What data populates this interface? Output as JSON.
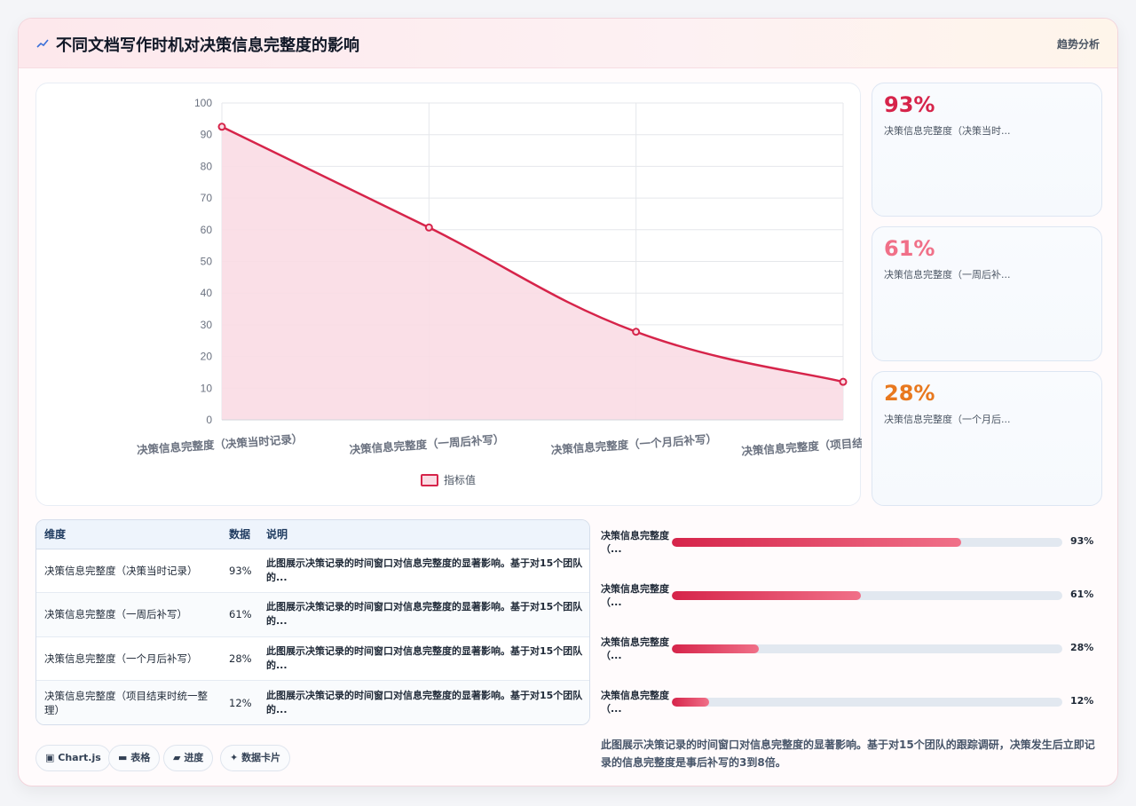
{
  "header": {
    "title": "不同文档写作时机对决策信息完整度的影响",
    "right_label": "趋势分析",
    "icon": "trend-line-icon"
  },
  "colors": {
    "line": "#d6244a",
    "area_fill": "#fadce4",
    "stat_1": "#d6244a",
    "stat_2": "#f07088",
    "stat_3": "#e8781e"
  },
  "chart_data": {
    "type": "line",
    "categories": [
      "决策信息完整度（决策当时记录）",
      "决策信息完整度（一周后补写）",
      "决策信息完整度（一个月后补写）",
      "决策信息完整度（项目结束时统一整理）"
    ],
    "series": [
      {
        "name": "指标值",
        "values": [
          92.5,
          60.7,
          27.8,
          12.0
        ]
      }
    ],
    "ylim": [
      0,
      100
    ],
    "yticks": [
      "0",
      "10",
      "20",
      "30",
      "40",
      "50",
      "60",
      "70",
      "80",
      "90",
      "100"
    ],
    "fill": true,
    "grid": true,
    "legend": "bottom"
  },
  "stats": [
    {
      "value": "93%",
      "label": "决策信息完整度（决策当时..."
    },
    {
      "value": "61%",
      "label": "决策信息完整度（一周后补..."
    },
    {
      "value": "28%",
      "label": "决策信息完整度（一个月后..."
    }
  ],
  "table": {
    "headers": [
      "维度",
      "数据",
      "说明"
    ],
    "rows": [
      {
        "dim": "决策信息完整度（决策当时记录）",
        "val": "93%",
        "desc": "此图展示决策记录的时间窗口对信息完整度的显著影响。基于对15个团队的..."
      },
      {
        "dim": "决策信息完整度（一周后补写）",
        "val": "61%",
        "desc": "此图展示决策记录的时间窗口对信息完整度的显著影响。基于对15个团队的..."
      },
      {
        "dim": "决策信息完整度（一个月后补写）",
        "val": "28%",
        "desc": "此图展示决策记录的时间窗口对信息完整度的显著影响。基于对15个团队的..."
      },
      {
        "dim": "决策信息完整度（项目结束时统一整理）",
        "val": "12%",
        "desc": "此图展示决策记录的时间窗口对信息完整度的显著影响。基于对15个团队的..."
      }
    ]
  },
  "progress": [
    {
      "label": "决策信息完整度（...",
      "value": "93%",
      "fraction": 0.74
    },
    {
      "label": "决策信息完整度（...",
      "value": "61%",
      "fraction": 0.485
    },
    {
      "label": "决策信息完整度（...",
      "value": "28%",
      "fraction": 0.222
    },
    {
      "label": "决策信息完整度（...",
      "value": "12%",
      "fraction": 0.095
    }
  ],
  "pills": [
    {
      "label": "Chart.js",
      "icon": "chart-icon"
    },
    {
      "label": "表格",
      "icon": "table-icon"
    },
    {
      "label": "进度",
      "icon": "progress-icon"
    },
    {
      "label": "数据卡片",
      "icon": "sparkle-icon"
    }
  ],
  "summary": "此图展示决策记录的时间窗口对信息完整度的显著影响。基于对15个团队的跟踪调研，决策发生后立即记录的信息完整度是事后补写的3到8倍。"
}
